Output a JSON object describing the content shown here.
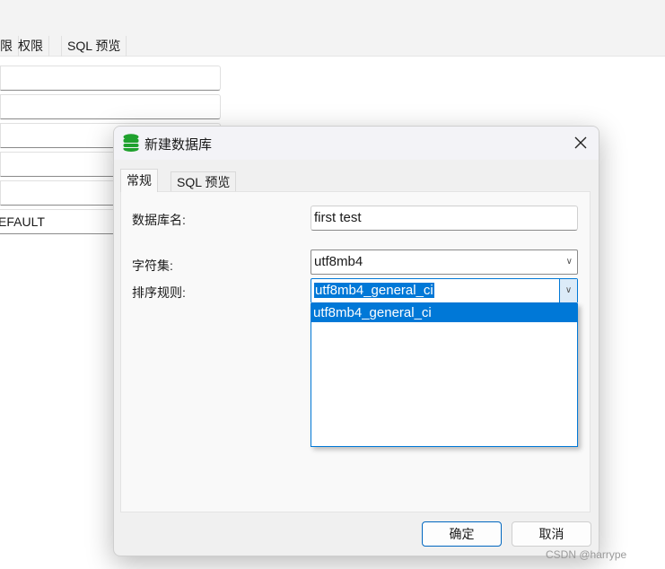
{
  "background": {
    "tabs": [
      "限",
      "权限",
      "SQL 预览"
    ],
    "rows": [
      "",
      "",
      "",
      "",
      "",
      "EFAULT"
    ]
  },
  "dialog": {
    "title": "新建数据库",
    "icon": "database-icon",
    "icon_color": "#1fa12e",
    "close_icon": "close-icon",
    "tabs": [
      {
        "label": "常规",
        "active": true
      },
      {
        "label": "SQL 预览",
        "active": false
      }
    ],
    "fields": {
      "name_label": "数据库名:",
      "name_value": "first test",
      "charset_label": "字符集:",
      "charset_value": "utf8mb4",
      "collation_label": "排序规则:",
      "collation_value": "utf8mb4_general_ci"
    },
    "dropdown_options": [
      "utf8mb4_general_ci"
    ],
    "ok_label": "确定",
    "cancel_label": "取消",
    "accent": "#0078d7"
  },
  "watermark": "CSDN @harrype"
}
